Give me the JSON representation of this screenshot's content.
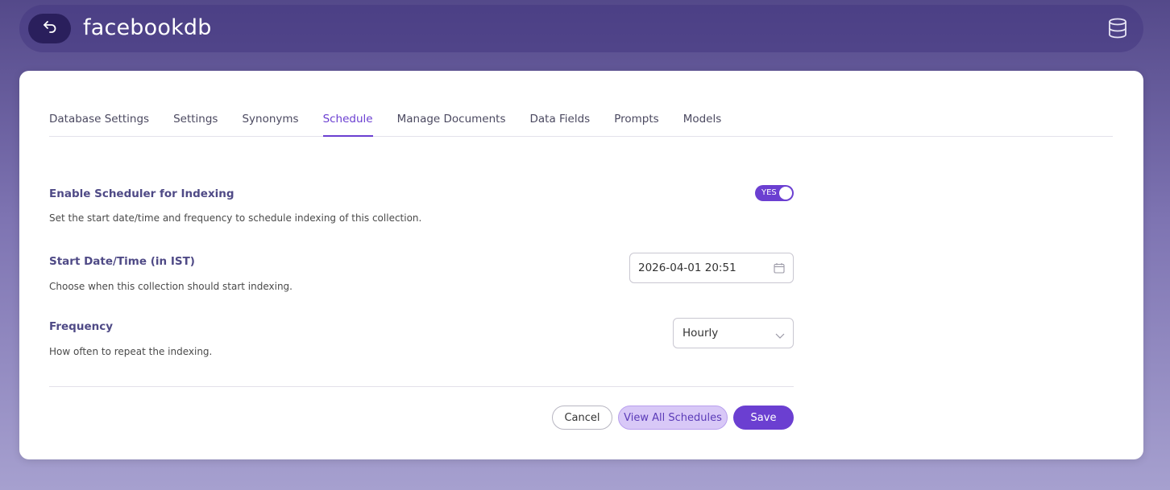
{
  "header": {
    "title": "facebookdb",
    "back_icon": "back-arrow-icon",
    "right_icon": "database-icon"
  },
  "tabs": [
    {
      "label": "Database Settings",
      "active": false
    },
    {
      "label": "Settings",
      "active": false
    },
    {
      "label": "Synonyms",
      "active": false
    },
    {
      "label": "Schedule",
      "active": true
    },
    {
      "label": "Manage Documents",
      "active": false
    },
    {
      "label": "Data Fields",
      "active": false
    },
    {
      "label": "Prompts",
      "active": false
    },
    {
      "label": "Models",
      "active": false
    }
  ],
  "scheduler": {
    "label": "Enable Scheduler for Indexing",
    "description": "Set the start date/time and frequency to schedule indexing of this collection.",
    "toggle_text": "YES",
    "enabled": true
  },
  "start": {
    "label": "Start Date/Time (in IST)",
    "description": "Choose when this collection should start indexing.",
    "value": "2026-04-01 20:51"
  },
  "frequency": {
    "label": "Frequency",
    "description": "How often to repeat the indexing.",
    "selected": "Hourly"
  },
  "actions": {
    "cancel": "Cancel",
    "view_all": "View All Schedules",
    "save": "Save"
  },
  "colors": {
    "accent": "#6b3fd1",
    "label": "#4f4a86",
    "header_bg": "#463882"
  }
}
